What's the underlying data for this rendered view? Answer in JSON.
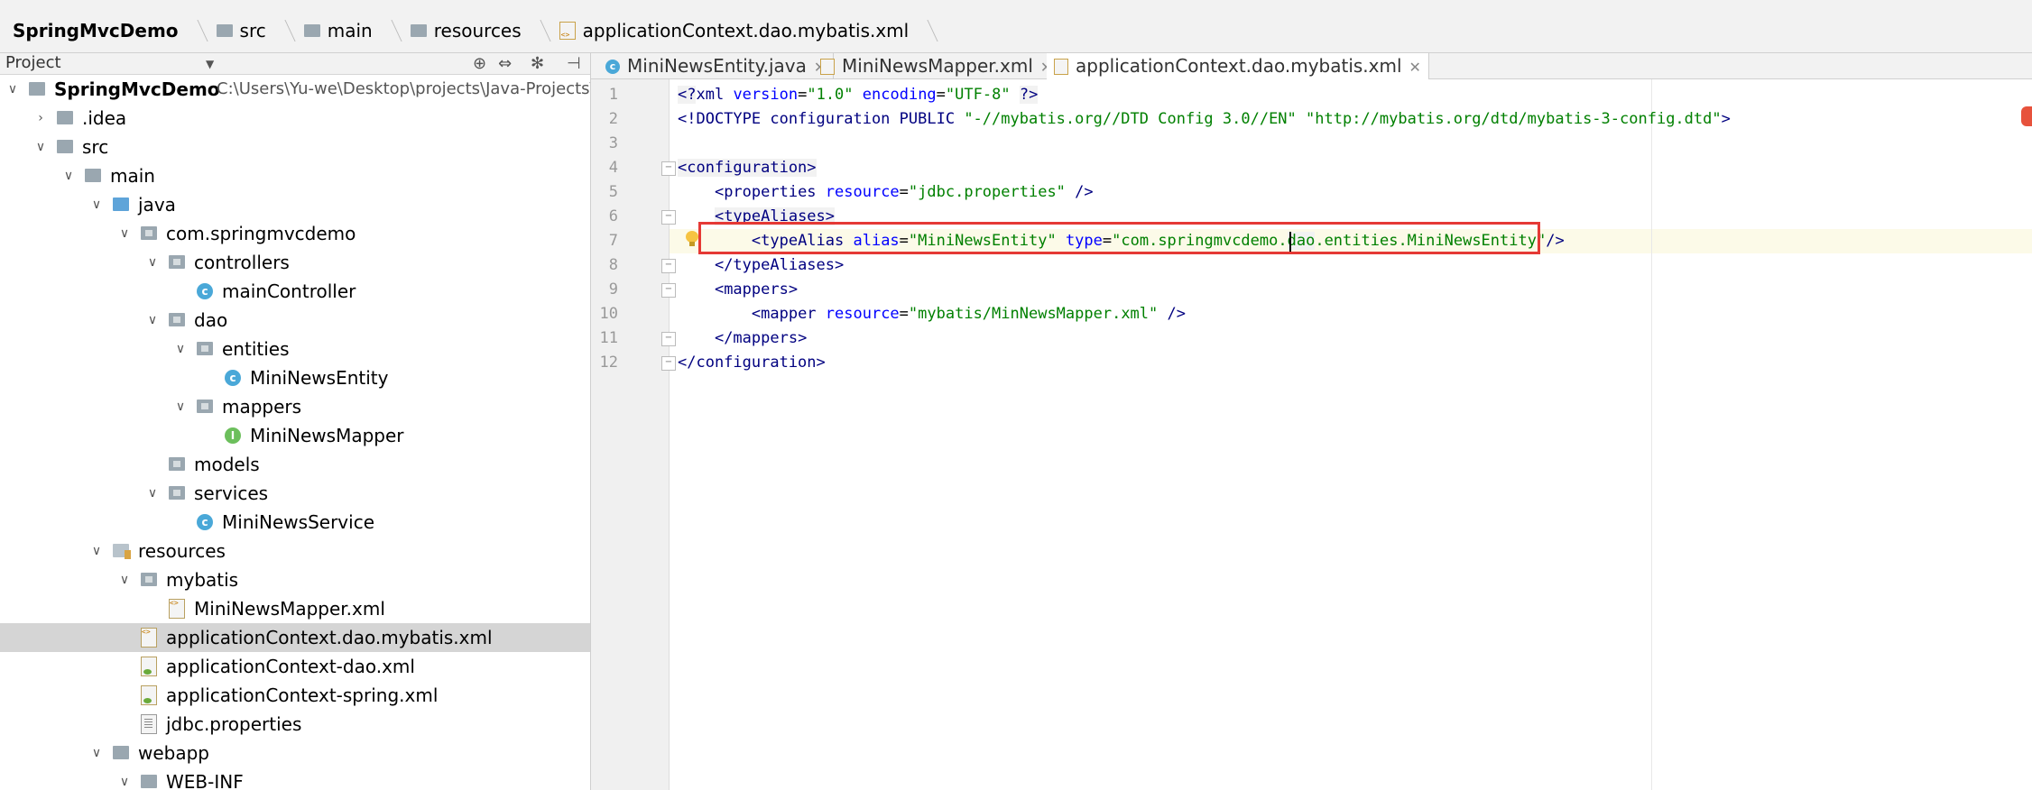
{
  "breadcrumb": {
    "items": [
      "SpringMvcDemo",
      "src",
      "main",
      "resources",
      "applicationContext.dao.mybatis.xml"
    ]
  },
  "project_panel": {
    "title": "Project",
    "tree": [
      {
        "label": "SpringMvcDemo",
        "path": "C:\\Users\\Yu-we\\Desktop\\projects\\Java-Projects\\Sprin",
        "icon": "module-folder-icon"
      },
      {
        "label": ".idea",
        "icon": "folder-icon"
      },
      {
        "label": "src",
        "icon": "folder-icon"
      },
      {
        "label": "main",
        "icon": "folder-icon"
      },
      {
        "label": "java",
        "icon": "source-folder-icon"
      },
      {
        "label": "com.springmvcdemo",
        "icon": "package-icon"
      },
      {
        "label": "controllers",
        "icon": "package-icon"
      },
      {
        "label": "mainController",
        "icon": "class-icon"
      },
      {
        "label": "dao",
        "icon": "package-icon"
      },
      {
        "label": "entities",
        "icon": "package-icon"
      },
      {
        "label": "MiniNewsEntity",
        "icon": "class-icon"
      },
      {
        "label": "mappers",
        "icon": "package-icon"
      },
      {
        "label": "MiniNewsMapper",
        "icon": "interface-icon"
      },
      {
        "label": "models",
        "icon": "package-icon"
      },
      {
        "label": "services",
        "icon": "package-icon"
      },
      {
        "label": "MiniNewsService",
        "icon": "class-icon"
      },
      {
        "label": "resources",
        "icon": "resources-folder-icon"
      },
      {
        "label": "mybatis",
        "icon": "package-icon"
      },
      {
        "label": "MiniNewsMapper.xml",
        "icon": "xml-file-icon"
      },
      {
        "label": "applicationContext.dao.mybatis.xml",
        "icon": "xml-file-icon"
      },
      {
        "label": "applicationContext-dao.xml",
        "icon": "spring-xml-icon"
      },
      {
        "label": "applicationContext-spring.xml",
        "icon": "spring-xml-icon"
      },
      {
        "label": "jdbc.properties",
        "icon": "properties-file-icon"
      },
      {
        "label": "webapp",
        "icon": "web-folder-icon"
      },
      {
        "label": "WEB-INF",
        "icon": "folder-icon"
      }
    ]
  },
  "tabs": [
    {
      "label": "MiniNewsEntity.java",
      "icon": "class-icon"
    },
    {
      "label": "MiniNewsMapper.xml",
      "icon": "xml-file-icon"
    },
    {
      "label": "applicationContext.dao.mybatis.xml",
      "icon": "xml-file-icon"
    }
  ],
  "editor": {
    "line_numbers": [
      "1",
      "2",
      "3",
      "4",
      "5",
      "6",
      "7",
      "8",
      "9",
      "10",
      "11",
      "12"
    ],
    "lines": [
      {
        "parts": [
          [
            "tagbg pi",
            "<?"
          ],
          [
            "pi",
            "xml "
          ],
          [
            "attr",
            "version"
          ],
          [
            "",
            "="
          ],
          [
            "val",
            "\"1.0\""
          ],
          [
            "",
            " "
          ],
          [
            "attr",
            "encoding"
          ],
          [
            "",
            "="
          ],
          [
            "val",
            "\"UTF-8\""
          ],
          [
            "",
            " "
          ],
          [
            "tagbg pi",
            "?>"
          ]
        ]
      },
      {
        "parts": [
          [
            "tag",
            "<!DOCTYPE "
          ],
          [
            "tag",
            "configuration "
          ],
          [
            "tag",
            "PUBLIC "
          ],
          [
            "val",
            "\"-//mybatis.org//DTD Config 3.0//EN\""
          ],
          [
            "",
            " "
          ],
          [
            "val",
            "\"http://mybatis.org/dtd/mybatis-3-config.dtd\""
          ],
          [
            "tag",
            ">"
          ]
        ]
      },
      {
        "parts": []
      },
      {
        "parts": [
          [
            "tagbg tag",
            "<configuration>"
          ]
        ]
      },
      {
        "parts": [
          [
            "",
            "    "
          ],
          [
            "tag",
            "<properties "
          ],
          [
            "attr",
            "resource"
          ],
          [
            "",
            "="
          ],
          [
            "val",
            "\"jdbc.properties\""
          ],
          [
            "",
            " "
          ],
          [
            "tag",
            "/>"
          ]
        ]
      },
      {
        "parts": [
          [
            "",
            "    "
          ],
          [
            "tagbg tag",
            "<typeAliases>"
          ]
        ]
      },
      {
        "parts": [
          [
            "",
            "        "
          ],
          [
            "tag",
            "<typeAlias "
          ],
          [
            "attr",
            "alias"
          ],
          [
            "",
            "="
          ],
          [
            "val",
            "\"MiniNewsEntity\""
          ],
          [
            "",
            " "
          ],
          [
            "attr",
            "type"
          ],
          [
            "",
            "="
          ],
          [
            "val",
            "\"com.springmvcdemo."
          ],
          [
            "val tagbg",
            "dao"
          ],
          [
            "val",
            ".entities.MiniNewsEntity\""
          ],
          [
            "tag",
            "/>"
          ]
        ]
      },
      {
        "parts": [
          [
            "",
            "    "
          ],
          [
            "tag",
            "</typeAliases>"
          ]
        ]
      },
      {
        "parts": [
          [
            "",
            "    "
          ],
          [
            "tag",
            "<mappers>"
          ]
        ]
      },
      {
        "parts": [
          [
            "",
            "        "
          ],
          [
            "tag",
            "<mapper "
          ],
          [
            "attr",
            "resource"
          ],
          [
            "",
            "="
          ],
          [
            "val",
            "\"mybatis/MinNewsMapper.xml\""
          ],
          [
            "",
            " "
          ],
          [
            "tag",
            "/>"
          ]
        ]
      },
      {
        "parts": [
          [
            "",
            "    "
          ],
          [
            "tag",
            "</mappers>"
          ]
        ]
      },
      {
        "parts": [
          [
            "tag",
            "</configuration>"
          ]
        ]
      }
    ]
  }
}
